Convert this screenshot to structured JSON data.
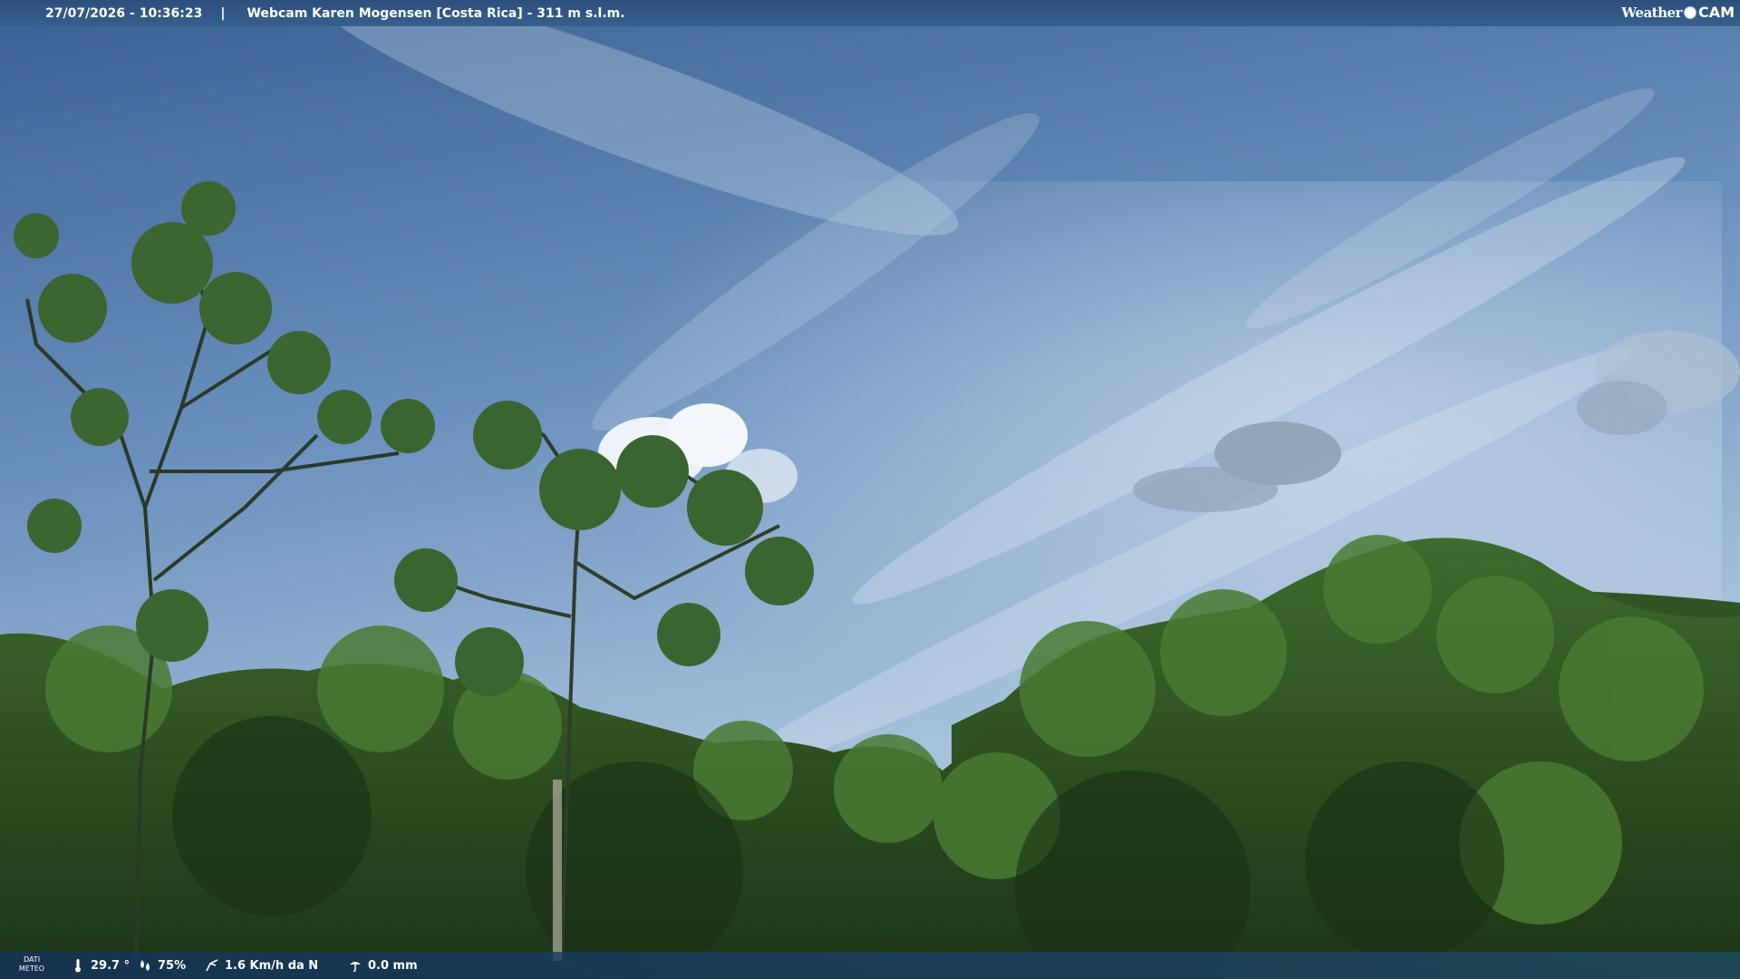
{
  "header": {
    "datetime": "27/07/2026 - 10:36:23",
    "separator": "|",
    "title": "Webcam Karen Mogensen [Costa Rica] - 311 m s.l.m.",
    "brand_left": "Weather",
    "brand_right": "CAM"
  },
  "footer": {
    "label_line1": "DATI",
    "label_line2": "METEO",
    "temperature": "29.7 °",
    "humidity": "75%",
    "wind": "1.6 Km/h da N",
    "rain": "0.0 mm"
  },
  "colors": {
    "sky_top": "#3f6797",
    "sky_mid": "#6f95c1",
    "sky_low": "#a9c3dd",
    "foliage_dark": "#1f3a19",
    "foliage_mid": "#355f26",
    "foliage_light": "#5d8a3c",
    "bar": "#2c4f7c"
  },
  "icons": {
    "temperature": "thermometer-icon",
    "humidity": "droplets-icon",
    "wind": "wind-icon",
    "rain": "rain-gauge-icon"
  }
}
